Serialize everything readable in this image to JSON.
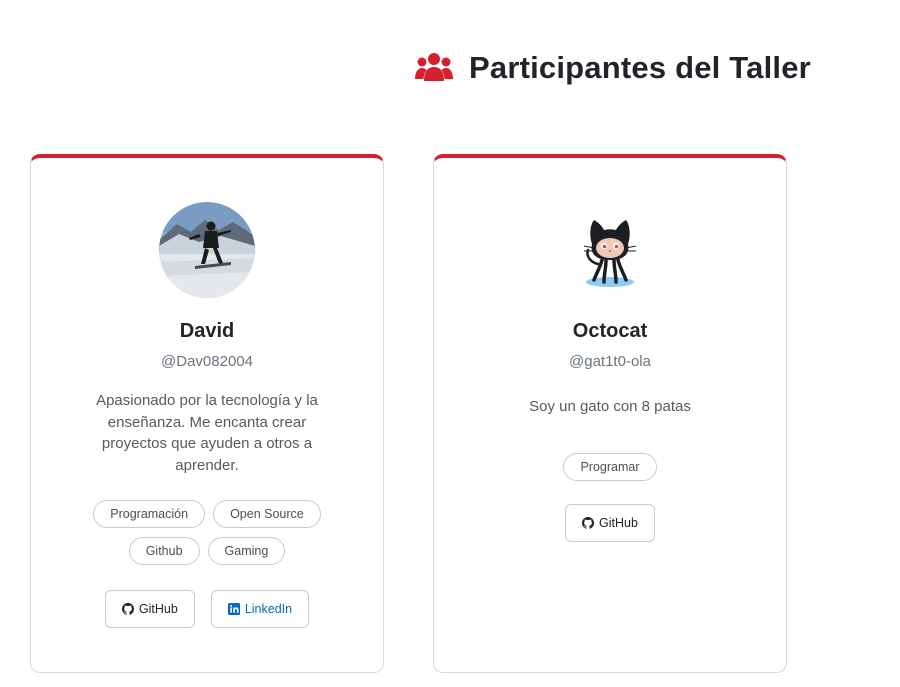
{
  "page": {
    "title": "Participantes del Taller",
    "title_icon": "users-icon",
    "accent_color": "#d3212d"
  },
  "participants": [
    {
      "name": "David",
      "handle": "@Dav082004",
      "bio": "Apasionado por la tecnología y la enseñanza. Me encanta crear proyectos que ayuden a otros a aprender.",
      "avatar": "snowboarder-photo",
      "tags": [
        "Programación",
        "Open Source",
        "Github",
        "Gaming"
      ],
      "links": [
        {
          "label": "GitHub",
          "icon": "github-icon"
        },
        {
          "label": "LinkedIn",
          "icon": "linkedin-icon"
        }
      ]
    },
    {
      "name": "Octocat",
      "handle": "@gat1t0-ola",
      "bio": "Soy un gato con 8 patas",
      "avatar": "octocat-image",
      "tags": [
        "Programar"
      ],
      "links": [
        {
          "label": "GitHub",
          "icon": "github-icon"
        }
      ]
    }
  ]
}
